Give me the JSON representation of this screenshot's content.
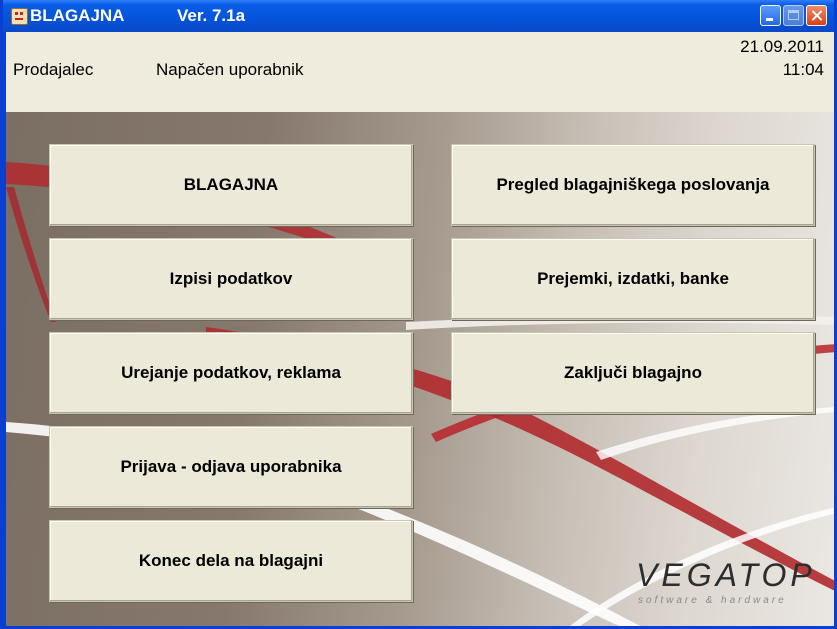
{
  "window": {
    "title": "BLAGAJNA",
    "version": "Ver. 7.1a"
  },
  "info": {
    "seller_label": "Prodajalec",
    "user_status": "Napačen uporabnik",
    "date": "21.09.2011",
    "time": "11:04"
  },
  "menu": {
    "left": [
      "BLAGAJNA",
      "Izpisi podatkov",
      "Urejanje podatkov, reklama",
      "Prijava - odjava uporabnika",
      "Konec dela na blagajni"
    ],
    "right": [
      "Pregled blagajniškega poslovanja",
      "Prejemki, izdatki, banke",
      "Zaključi blagajno"
    ]
  },
  "logo": {
    "name": "VEGATOP",
    "tagline": "software & hardware"
  },
  "colors": {
    "titlebar": "#0453d9",
    "infobar": "#efebdd",
    "button_face": "#ece9d8",
    "swoosh_red": "#b02a2e"
  }
}
